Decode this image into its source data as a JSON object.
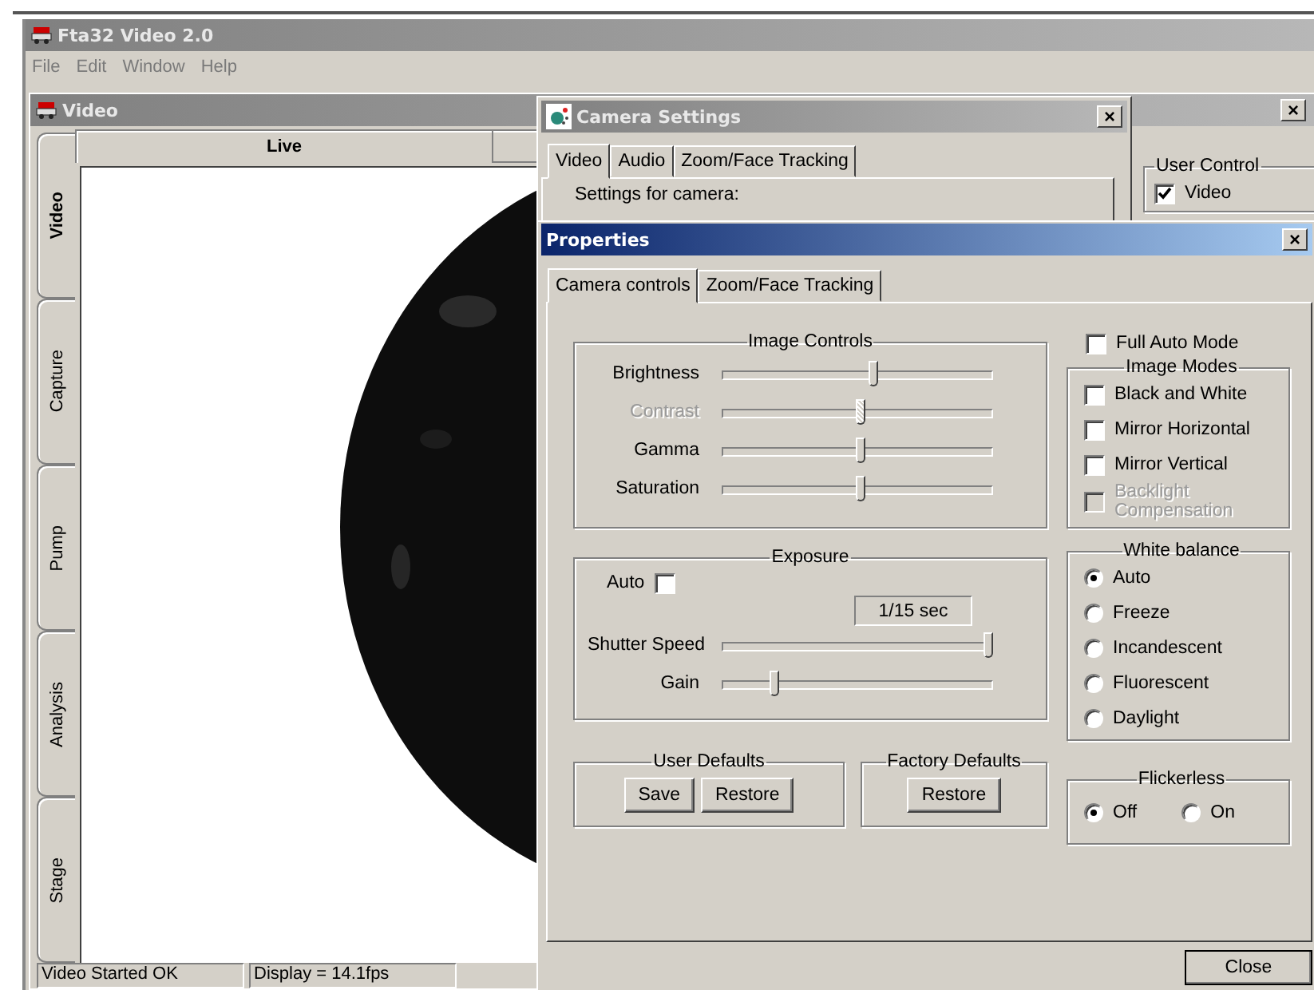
{
  "app": {
    "title": "Fta32 Video 2.0",
    "menu": [
      "File",
      "Edit",
      "Window",
      "Help"
    ]
  },
  "video_window": {
    "title": "Video",
    "close": "×",
    "side_tabs": [
      {
        "label": "Video",
        "selected": true
      },
      {
        "label": "Capture",
        "selected": false
      },
      {
        "label": "Pump",
        "selected": false
      },
      {
        "label": "Analysis",
        "selected": false
      },
      {
        "label": "Stage",
        "selected": false
      }
    ],
    "top_tabs": [
      {
        "label": "Live",
        "selected": true
      }
    ],
    "status_bar": [
      "Video Started OK",
      "Display =  14.1fps"
    ]
  },
  "camera_settings": {
    "title": "Camera Settings",
    "close": "×",
    "tabs": [
      {
        "label": "Video",
        "selected": true
      },
      {
        "label": "Audio",
        "selected": false
      },
      {
        "label": "Zoom/Face Tracking",
        "selected": false
      }
    ],
    "label": "Settings for camera:"
  },
  "user_control": {
    "title": "User Control",
    "checkboxes": [
      {
        "label": "Video",
        "checked": true
      }
    ]
  },
  "properties": {
    "title": "Properties",
    "close": "×",
    "tabs": [
      {
        "label": "Camera controls",
        "selected": true
      },
      {
        "label": "Zoom/Face Tracking",
        "selected": false
      }
    ],
    "image_controls": {
      "title": "Image Controls",
      "sliders": [
        {
          "label": "Brightness",
          "level": 0.56,
          "disabled": false
        },
        {
          "label": "Contrast",
          "level": 0.51,
          "disabled": true
        },
        {
          "label": "Gamma",
          "level": 0.51,
          "disabled": false
        },
        {
          "label": "Saturation",
          "level": 0.51,
          "disabled": false
        }
      ]
    },
    "exposure": {
      "title": "Exposure",
      "auto_label": "Auto",
      "auto_checked": false,
      "value": "1/15 sec",
      "sliders": [
        {
          "label": "Shutter Speed",
          "level": 1.0,
          "disabled": false
        },
        {
          "label": "Gain",
          "level": 0.18,
          "disabled": false
        }
      ]
    },
    "user_defaults": {
      "title": "User Defaults",
      "buttons": [
        "Save",
        "Restore"
      ]
    },
    "factory_defaults": {
      "title": "Factory Defaults",
      "buttons": [
        "Restore"
      ]
    },
    "full_auto": {
      "label": "Full Auto Mode",
      "checked": false
    },
    "image_modes": {
      "title": "Image Modes",
      "checkboxes": [
        {
          "label": "Black and White",
          "checked": false,
          "disabled": false
        },
        {
          "label": "Mirror Horizontal",
          "checked": false,
          "disabled": false
        },
        {
          "label": "Mirror Vertical",
          "checked": false,
          "disabled": false
        },
        {
          "label": "Backlight Compensation",
          "checked": false,
          "disabled": true
        }
      ]
    },
    "white_balance": {
      "title": "White balance",
      "options": [
        {
          "label": "Auto",
          "selected": true
        },
        {
          "label": "Freeze",
          "selected": false
        },
        {
          "label": "Incandescent",
          "selected": false
        },
        {
          "label": "Fluorescent",
          "selected": false
        },
        {
          "label": "Daylight",
          "selected": false
        }
      ]
    },
    "flickerless": {
      "title": "Flickerless",
      "options": [
        {
          "label": "Off",
          "selected": true
        },
        {
          "label": "On",
          "selected": false
        }
      ]
    },
    "close_button": "Close"
  }
}
